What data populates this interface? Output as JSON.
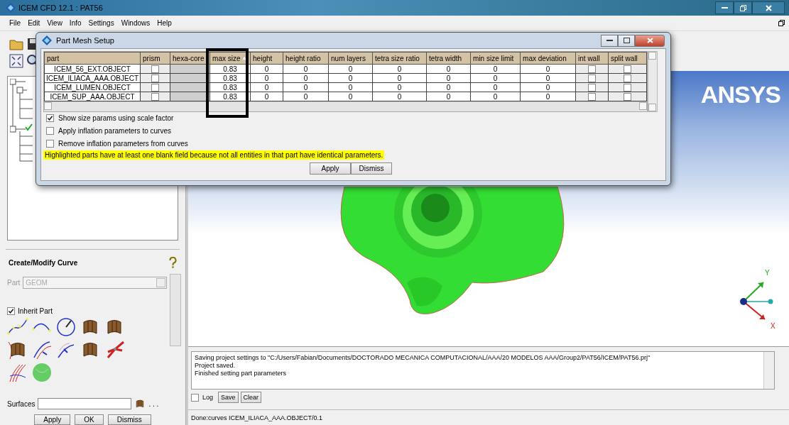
{
  "app_window": {
    "title": "ICEM CFD 12.1 : PAT56"
  },
  "menu": [
    "File",
    "Edit",
    "View",
    "Info",
    "Settings",
    "Windows",
    "Help"
  ],
  "dialog": {
    "title": "Part Mesh Setup",
    "columns": [
      {
        "label": "part",
        "sorted": false
      },
      {
        "label": "prism",
        "sorted": false
      },
      {
        "label": "hexa-core",
        "sorted": false
      },
      {
        "label": "max size",
        "sorted": true
      },
      {
        "label": "height",
        "sorted": false
      },
      {
        "label": "height ratio",
        "sorted": false
      },
      {
        "label": "num layers",
        "sorted": false
      },
      {
        "label": "tetra size ratio",
        "sorted": false
      },
      {
        "label": "tetra width",
        "sorted": false
      },
      {
        "label": "min size limit",
        "sorted": false
      },
      {
        "label": "max deviation",
        "sorted": false
      },
      {
        "label": "int wall",
        "sorted": false
      },
      {
        "label": "split wall",
        "sorted": false
      }
    ],
    "rows": [
      {
        "part": "ICEM_56_EXT.OBJECT",
        "prism": false,
        "values": [
          "0.83",
          "0",
          "0",
          "0",
          "0",
          "0",
          "0",
          "0"
        ],
        "int_wall": false,
        "split_wall": false
      },
      {
        "part": "ICEM_ILIACA_AAA.OBJECT",
        "prism": false,
        "values": [
          "0.83",
          "0",
          "0",
          "0",
          "0",
          "0",
          "0",
          "0"
        ],
        "int_wall": false,
        "split_wall": false
      },
      {
        "part": "ICEM_LUMEN.OBJECT",
        "prism": false,
        "values": [
          "0.83",
          "0",
          "0",
          "0",
          "0",
          "0",
          "0",
          "0"
        ],
        "int_wall": false,
        "split_wall": false
      },
      {
        "part": "ICEM_SUP_AAA.OBJECT",
        "prism": false,
        "values": [
          "0.83",
          "0",
          "0",
          "0",
          "0",
          "0",
          "0",
          "0"
        ],
        "int_wall": false,
        "split_wall": false
      }
    ],
    "options": [
      {
        "label": "Show size params using scale factor",
        "checked": true
      },
      {
        "label": "Apply inflation parameters to curves",
        "checked": false
      },
      {
        "label": "Remove inflation parameters from curves",
        "checked": false
      }
    ],
    "notice": "Highlighted parts have at least one blank field because not all entities in that part have identical parameters.",
    "buttons": [
      "Apply",
      "Dismiss"
    ]
  },
  "left_panel": {
    "title": "Create/Modify Curve",
    "part_label": "Part",
    "part_value": "GEOM",
    "inherit_part": {
      "label": "Inherit Part",
      "checked": true
    },
    "surfaces_label": "Surfaces",
    "more": ". . .",
    "buttons": [
      "Apply",
      "OK",
      "Dismiss"
    ]
  },
  "viewport": {
    "logo": "ANSYS",
    "axis_labels": [
      "Y",
      "X"
    ]
  },
  "log": {
    "lines": [
      "Saving project settings to \"C:/Users/Fabian/Documents/DOCTORADO MECANICA COMPUTACIONAL/AAA/20 MODELOS AAA/Group2/PAT56/ICEM/PAT56.prj\"",
      "Project saved.",
      "Finished setting part parameters"
    ],
    "log_option": {
      "label": "Log",
      "checked": false
    },
    "buttons": [
      "Save",
      "Clear"
    ]
  },
  "status_bar": "Done:curves ICEM_ILIACA_AAA.OBJECT/0.1"
}
